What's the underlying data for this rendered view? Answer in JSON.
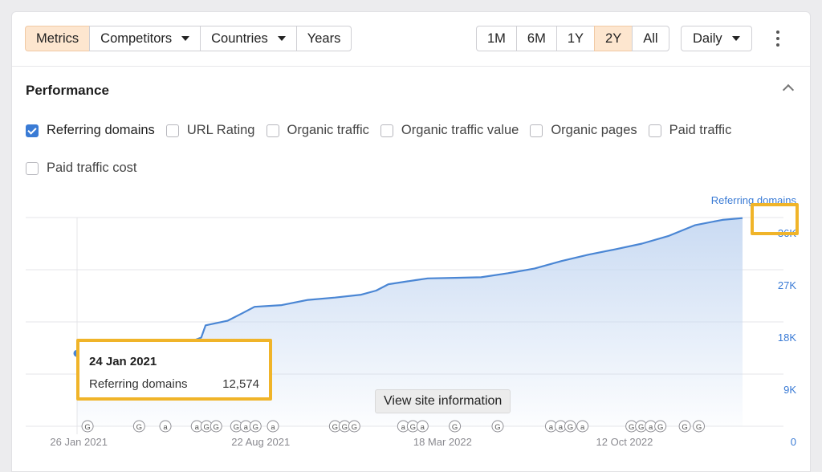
{
  "toolbar": {
    "left_tabs": [
      {
        "label": "Metrics",
        "active": true,
        "dropdown": false
      },
      {
        "label": "Competitors",
        "active": false,
        "dropdown": true
      },
      {
        "label": "Countries",
        "active": false,
        "dropdown": true
      },
      {
        "label": "Years",
        "active": false,
        "dropdown": false
      }
    ],
    "ranges": [
      {
        "label": "1M",
        "active": false
      },
      {
        "label": "6M",
        "active": false
      },
      {
        "label": "1Y",
        "active": false
      },
      {
        "label": "2Y",
        "active": true
      },
      {
        "label": "All",
        "active": false
      }
    ],
    "interval": "Daily"
  },
  "section": {
    "title": "Performance"
  },
  "metrics": [
    {
      "label": "Referring domains",
      "checked": true
    },
    {
      "label": "URL Rating",
      "checked": false
    },
    {
      "label": "Organic traffic",
      "checked": false
    },
    {
      "label": "Organic traffic value",
      "checked": false
    },
    {
      "label": "Organic pages",
      "checked": false
    },
    {
      "label": "Paid traffic",
      "checked": false
    },
    {
      "label": "Paid traffic cost",
      "checked": false
    }
  ],
  "tooltip": {
    "date": "24 Jan 2021",
    "label": "Referring domains",
    "value": "12,574"
  },
  "hover_tip": "View site information",
  "colors": {
    "line": "#4a86d4",
    "area_top": "#c7d9f2",
    "accent_bg": "#fde6cf",
    "highlight": "#f0b429",
    "axis_text": "#3a7bd5"
  },
  "chart_data": {
    "type": "area",
    "series": [
      {
        "name": "Referring domains",
        "points": [
          [
            "2021-01-24",
            12574
          ],
          [
            "2021-03-01",
            12750
          ],
          [
            "2021-04-01",
            13500
          ],
          [
            "2021-05-01",
            14100
          ],
          [
            "2021-06-01",
            14500
          ],
          [
            "2021-06-15",
            15300
          ],
          [
            "2021-06-20",
            17400
          ],
          [
            "2021-07-15",
            18200
          ],
          [
            "2021-08-01",
            19500
          ],
          [
            "2021-08-15",
            20600
          ],
          [
            "2021-09-15",
            20900
          ],
          [
            "2021-10-15",
            21800
          ],
          [
            "2021-11-15",
            22200
          ],
          [
            "2021-12-15",
            22700
          ],
          [
            "2022-01-01",
            23400
          ],
          [
            "2022-01-15",
            24500
          ],
          [
            "2022-02-15",
            25200
          ],
          [
            "2022-03-01",
            25500
          ],
          [
            "2022-04-01",
            25600
          ],
          [
            "2022-05-01",
            25700
          ],
          [
            "2022-06-01",
            26400
          ],
          [
            "2022-07-01",
            27200
          ],
          [
            "2022-08-01",
            28500
          ],
          [
            "2022-09-01",
            29600
          ],
          [
            "2022-10-01",
            30500
          ],
          [
            "2022-11-01",
            31500
          ],
          [
            "2022-12-01",
            32800
          ],
          [
            "2023-01-01",
            34700
          ],
          [
            "2023-02-01",
            35600
          ],
          [
            "2023-02-24",
            35900
          ]
        ]
      }
    ],
    "x_ticks": [
      "26 Jan 2021",
      "22 Aug 2021",
      "18 Mar 2022",
      "12 Oct 2022"
    ],
    "y_ticks": [
      "0",
      "9K",
      "18K",
      "27K",
      "36K"
    ],
    "y_axis_title": "Referring domains",
    "ylim": [
      0,
      36000
    ],
    "grid": true,
    "annotation_markers": {
      "groups": [
        [
          "G"
        ],
        [
          "G"
        ],
        [
          "a"
        ],
        [
          "a",
          "G",
          "G"
        ],
        [
          "G",
          "a",
          "G"
        ],
        [
          "a"
        ],
        [
          "G",
          "G",
          "G"
        ],
        [
          "a",
          "G",
          "a"
        ],
        [
          "G"
        ],
        [
          "G"
        ],
        [
          "a",
          "a",
          "G"
        ],
        [
          "a"
        ],
        [
          "G",
          "G",
          "a",
          "G"
        ],
        [
          "G"
        ],
        [
          "G"
        ]
      ]
    }
  }
}
